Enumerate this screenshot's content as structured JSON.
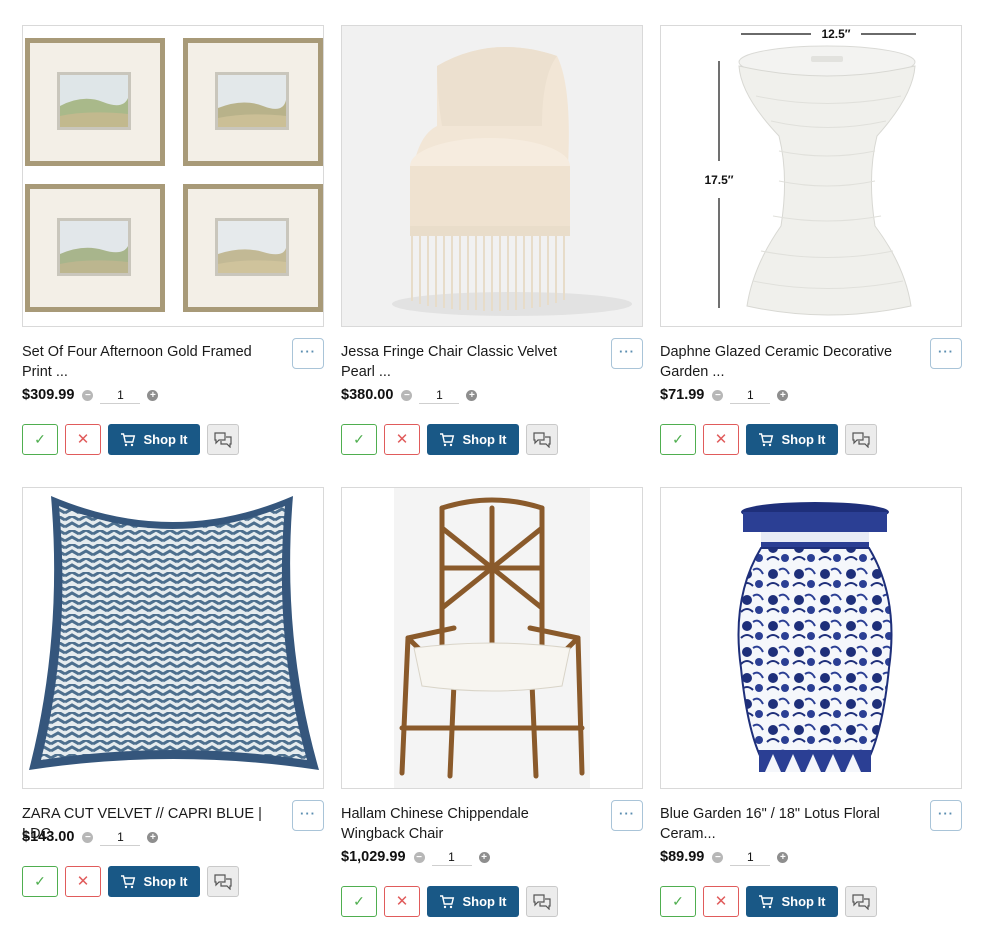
{
  "products": [
    {
      "title": "Set Of Four Afternoon Gold Framed Print ...",
      "price": "$309.99",
      "qty": "1",
      "shop_label": "Shop It",
      "image_icon": "framed-prints-image"
    },
    {
      "title": "Jessa Fringe Chair Classic Velvet Pearl ...",
      "price": "$380.00",
      "qty": "1",
      "shop_label": "Shop It",
      "image_icon": "fringe-chair-image"
    },
    {
      "title": "Daphne Glazed Ceramic Decorative Garden ...",
      "price": "$71.99",
      "qty": "1",
      "shop_label": "Shop It",
      "image_icon": "garden-stool-image",
      "dim_width": "12.5″",
      "dim_height": "17.5″"
    },
    {
      "title": "ZARA CUT VELVET // CAPRI BLUE | LDC",
      "price": "$143.00",
      "qty": "1",
      "shop_label": "Shop It",
      "image_icon": "pillow-image"
    },
    {
      "title": "Hallam Chinese Chippendale Wingback Chair",
      "price": "$1,029.99",
      "qty": "1",
      "shop_label": "Shop It",
      "image_icon": "bamboo-chair-image"
    },
    {
      "title": "Blue Garden 16\" / 18\" Lotus Floral Ceram...",
      "price": "$89.99",
      "qty": "1",
      "shop_label": "Shop It",
      "image_icon": "ceramic-stool-image"
    }
  ],
  "colors": {
    "accent": "#195886",
    "approve": "#4fae4f",
    "reject": "#e05b5b"
  }
}
